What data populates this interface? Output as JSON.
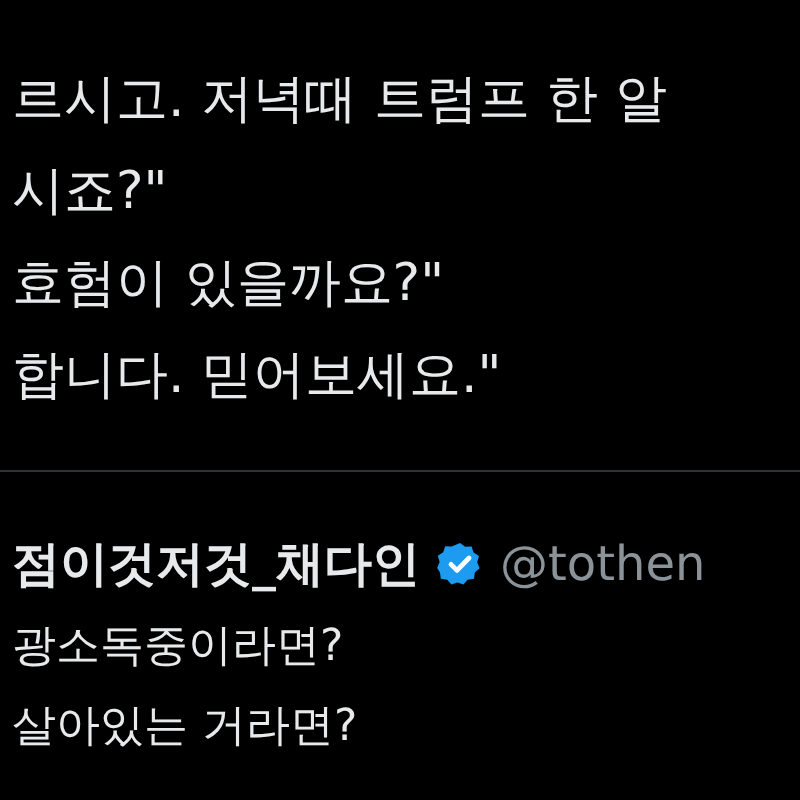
{
  "tweet": {
    "lines": [
      "르시고. 저녁때 트럼프 한 알",
      "시죠?\"",
      "효험이 있을까요?\"",
      "합니다. 믿어보세요.\""
    ]
  },
  "reply": {
    "author": {
      "name": "점이것저것_채다인",
      "verified": true,
      "handle": "@tothen"
    },
    "lines": [
      "광소독중이라면?",
      "살아있는 거라면?"
    ]
  }
}
